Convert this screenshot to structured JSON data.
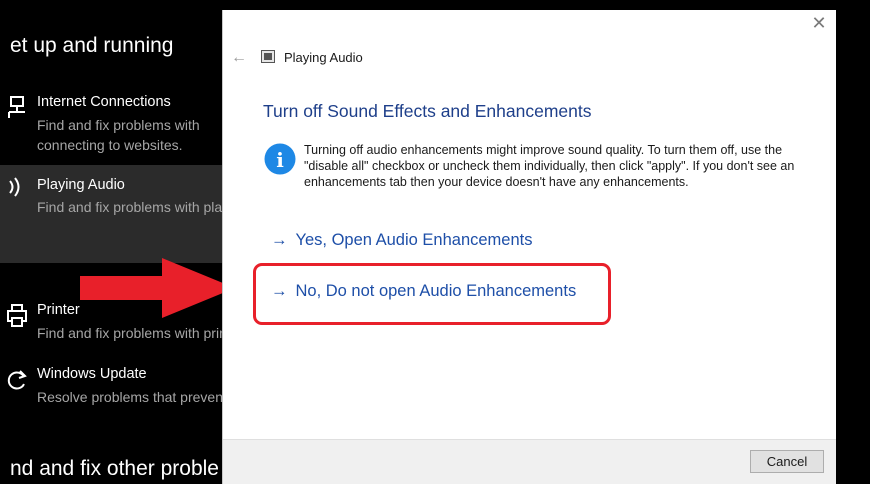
{
  "background": {
    "heading": "et up and running",
    "footer_heading": "nd and fix other proble",
    "items": [
      {
        "title": "Internet Connections",
        "desc": "Find and fix problems with connecting to websites."
      },
      {
        "title": "Playing Audio",
        "desc": "Find and fix problems with playing sound"
      },
      {
        "title": "Printer",
        "desc": "Find and fix problems with printing"
      },
      {
        "title": "Windows Update",
        "desc": "Resolve problems that prevent updating"
      }
    ]
  },
  "dialog": {
    "title": "Playing Audio",
    "heading": "Turn off Sound Effects and Enhancements",
    "info_text": "Turning off audio enhancements might improve sound quality. To turn them off, use the \"disable all\" checkbox or uncheck them individually, then click \"apply\". If you don't see an enhancements tab then your device doesn't have any enhancements.",
    "link_yes": "Yes, Open Audio Enhancements",
    "link_no": "No, Do not open Audio Enhancements",
    "arrow_glyph": "→",
    "back_glyph": "←",
    "close_glyph": "✕",
    "info_glyph": "i",
    "cancel_label": "Cancel"
  },
  "colors": {
    "link": "#1e4fa8",
    "heading": "#1e3f8a",
    "highlight": "#e8202a",
    "info": "#1e88e5"
  }
}
